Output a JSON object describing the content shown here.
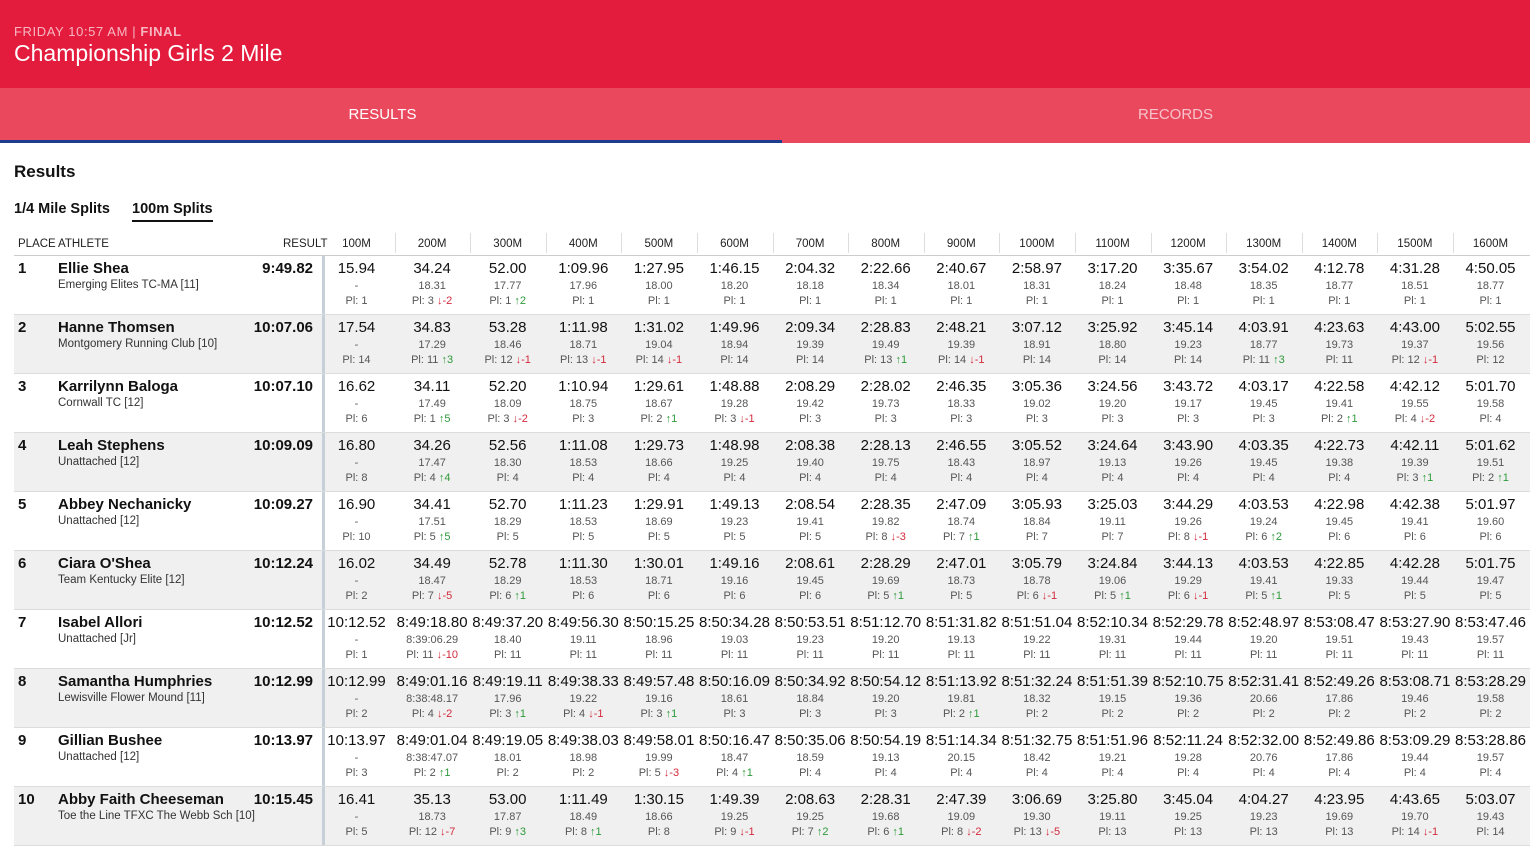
{
  "header": {
    "day_time": "FRIDAY 10:57 AM | ",
    "status": "FINAL",
    "title": "Championship Girls 2 Mile"
  },
  "tabs": [
    {
      "label": "RESULTS",
      "active": true
    },
    {
      "label": "RECORDS",
      "active": false
    }
  ],
  "section_title": "Results",
  "split_tabs": [
    {
      "label": "1/4 Mile Splits",
      "active": false
    },
    {
      "label": "100m Splits",
      "active": true
    }
  ],
  "columns": {
    "place": "PLACE",
    "athlete": "ATHLETE",
    "result": "RESULT",
    "splits": [
      "100M",
      "200M",
      "300M",
      "400M",
      "500M",
      "600M",
      "700M",
      "800M",
      "900M",
      "1000M",
      "1100M",
      "1200M",
      "1300M",
      "1400M",
      "1500M",
      "1600M"
    ]
  },
  "colors": {
    "header_bg": "#e31c3d",
    "tab_bg": "#e9485d",
    "tab_indicator": "#1e3d8f",
    "up": "#2e9a3a",
    "down": "#d42a3c"
  },
  "rows": [
    {
      "place": "1",
      "name": "Ellie Shea",
      "team": "Emerging Elites TC-MA [11]",
      "result": "9:49.82",
      "splits": [
        [
          "15.94",
          "-",
          "Pl: 1"
        ],
        [
          "34.24",
          "18.31",
          "Pl: 3",
          "↓-2"
        ],
        [
          "52.00",
          "17.77",
          "Pl: 1",
          "↑2"
        ],
        [
          "1:09.96",
          "17.96",
          "Pl: 1"
        ],
        [
          "1:27.95",
          "18.00",
          "Pl: 1"
        ],
        [
          "1:46.15",
          "18.20",
          "Pl: 1"
        ],
        [
          "2:04.32",
          "18.18",
          "Pl: 1"
        ],
        [
          "2:22.66",
          "18.34",
          "Pl: 1"
        ],
        [
          "2:40.67",
          "18.01",
          "Pl: 1"
        ],
        [
          "2:58.97",
          "18.31",
          "Pl: 1"
        ],
        [
          "3:17.20",
          "18.24",
          "Pl: 1"
        ],
        [
          "3:35.67",
          "18.48",
          "Pl: 1"
        ],
        [
          "3:54.02",
          "18.35",
          "Pl: 1"
        ],
        [
          "4:12.78",
          "18.77",
          "Pl: 1"
        ],
        [
          "4:31.28",
          "18.51",
          "Pl: 1"
        ],
        [
          "4:50.05",
          "18.77",
          "Pl: 1"
        ]
      ]
    },
    {
      "place": "2",
      "name": "Hanne Thomsen",
      "team": "Montgomery Running Club [10]",
      "result": "10:07.06",
      "splits": [
        [
          "17.54",
          "-",
          "Pl: 14"
        ],
        [
          "34.83",
          "17.29",
          "Pl: 11",
          "↑3"
        ],
        [
          "53.28",
          "18.46",
          "Pl: 12",
          "↓-1"
        ],
        [
          "1:11.98",
          "18.71",
          "Pl: 13",
          "↓-1"
        ],
        [
          "1:31.02",
          "19.04",
          "Pl: 14",
          "↓-1"
        ],
        [
          "1:49.96",
          "18.94",
          "Pl: 14"
        ],
        [
          "2:09.34",
          "19.39",
          "Pl: 14"
        ],
        [
          "2:28.83",
          "19.49",
          "Pl: 13",
          "↑1"
        ],
        [
          "2:48.21",
          "19.39",
          "Pl: 14",
          "↓-1"
        ],
        [
          "3:07.12",
          "18.91",
          "Pl: 14"
        ],
        [
          "3:25.92",
          "18.80",
          "Pl: 14"
        ],
        [
          "3:45.14",
          "19.23",
          "Pl: 14"
        ],
        [
          "4:03.91",
          "18.77",
          "Pl: 11",
          "↑3"
        ],
        [
          "4:23.63",
          "19.73",
          "Pl: 11"
        ],
        [
          "4:43.00",
          "19.37",
          "Pl: 12",
          "↓-1"
        ],
        [
          "5:02.55",
          "19.56",
          "Pl: 12"
        ]
      ]
    },
    {
      "place": "3",
      "name": "Karrilynn Baloga",
      "team": "Cornwall TC [12]",
      "result": "10:07.10",
      "splits": [
        [
          "16.62",
          "-",
          "Pl: 6"
        ],
        [
          "34.11",
          "17.49",
          "Pl: 1",
          "↑5"
        ],
        [
          "52.20",
          "18.09",
          "Pl: 3",
          "↓-2"
        ],
        [
          "1:10.94",
          "18.75",
          "Pl: 3"
        ],
        [
          "1:29.61",
          "18.67",
          "Pl: 2",
          "↑1"
        ],
        [
          "1:48.88",
          "19.28",
          "Pl: 3",
          "↓-1"
        ],
        [
          "2:08.29",
          "19.42",
          "Pl: 3"
        ],
        [
          "2:28.02",
          "19.73",
          "Pl: 3"
        ],
        [
          "2:46.35",
          "18.33",
          "Pl: 3"
        ],
        [
          "3:05.36",
          "19.02",
          "Pl: 3"
        ],
        [
          "3:24.56",
          "19.20",
          "Pl: 3"
        ],
        [
          "3:43.72",
          "19.17",
          "Pl: 3"
        ],
        [
          "4:03.17",
          "19.45",
          "Pl: 3"
        ],
        [
          "4:22.58",
          "19.41",
          "Pl: 2",
          "↑1"
        ],
        [
          "4:42.12",
          "19.55",
          "Pl: 4",
          "↓-2"
        ],
        [
          "5:01.70",
          "19.58",
          "Pl: 4"
        ]
      ]
    },
    {
      "place": "4",
      "name": "Leah Stephens",
      "team": "Unattached [12]",
      "result": "10:09.09",
      "splits": [
        [
          "16.80",
          "-",
          "Pl: 8"
        ],
        [
          "34.26",
          "17.47",
          "Pl: 4",
          "↑4"
        ],
        [
          "52.56",
          "18.30",
          "Pl: 4"
        ],
        [
          "1:11.08",
          "18.53",
          "Pl: 4"
        ],
        [
          "1:29.73",
          "18.66",
          "Pl: 4"
        ],
        [
          "1:48.98",
          "19.25",
          "Pl: 4"
        ],
        [
          "2:08.38",
          "19.40",
          "Pl: 4"
        ],
        [
          "2:28.13",
          "19.75",
          "Pl: 4"
        ],
        [
          "2:46.55",
          "18.43",
          "Pl: 4"
        ],
        [
          "3:05.52",
          "18.97",
          "Pl: 4"
        ],
        [
          "3:24.64",
          "19.13",
          "Pl: 4"
        ],
        [
          "3:43.90",
          "19.26",
          "Pl: 4"
        ],
        [
          "4:03.35",
          "19.45",
          "Pl: 4"
        ],
        [
          "4:22.73",
          "19.38",
          "Pl: 4"
        ],
        [
          "4:42.11",
          "19.39",
          "Pl: 3",
          "↑1"
        ],
        [
          "5:01.62",
          "19.51",
          "Pl: 2",
          "↑1"
        ]
      ]
    },
    {
      "place": "5",
      "name": "Abbey Nechanicky",
      "team": "Unattached [12]",
      "result": "10:09.27",
      "splits": [
        [
          "16.90",
          "-",
          "Pl: 10"
        ],
        [
          "34.41",
          "17.51",
          "Pl: 5",
          "↑5"
        ],
        [
          "52.70",
          "18.29",
          "Pl: 5"
        ],
        [
          "1:11.23",
          "18.53",
          "Pl: 5"
        ],
        [
          "1:29.91",
          "18.69",
          "Pl: 5"
        ],
        [
          "1:49.13",
          "19.23",
          "Pl: 5"
        ],
        [
          "2:08.54",
          "19.41",
          "Pl: 5"
        ],
        [
          "2:28.35",
          "19.82",
          "Pl: 8",
          "↓-3"
        ],
        [
          "2:47.09",
          "18.74",
          "Pl: 7",
          "↑1"
        ],
        [
          "3:05.93",
          "18.84",
          "Pl: 7"
        ],
        [
          "3:25.03",
          "19.11",
          "Pl: 7"
        ],
        [
          "3:44.29",
          "19.26",
          "Pl: 8",
          "↓-1"
        ],
        [
          "4:03.53",
          "19.24",
          "Pl: 6",
          "↑2"
        ],
        [
          "4:22.98",
          "19.45",
          "Pl: 6"
        ],
        [
          "4:42.38",
          "19.41",
          "Pl: 6"
        ],
        [
          "5:01.97",
          "19.60",
          "Pl: 6"
        ]
      ]
    },
    {
      "place": "6",
      "name": "Ciara O'Shea",
      "team": "Team Kentucky Elite [12]",
      "result": "10:12.24",
      "splits": [
        [
          "16.02",
          "-",
          "Pl: 2"
        ],
        [
          "34.49",
          "18.47",
          "Pl: 7",
          "↓-5"
        ],
        [
          "52.78",
          "18.29",
          "Pl: 6",
          "↑1"
        ],
        [
          "1:11.30",
          "18.53",
          "Pl: 6"
        ],
        [
          "1:30.01",
          "18.71",
          "Pl: 6"
        ],
        [
          "1:49.16",
          "19.16",
          "Pl: 6"
        ],
        [
          "2:08.61",
          "19.45",
          "Pl: 6"
        ],
        [
          "2:28.29",
          "19.69",
          "Pl: 5",
          "↑1"
        ],
        [
          "2:47.01",
          "18.73",
          "Pl: 5"
        ],
        [
          "3:05.79",
          "18.78",
          "Pl: 6",
          "↓-1"
        ],
        [
          "3:24.84",
          "19.06",
          "Pl: 5",
          "↑1"
        ],
        [
          "3:44.13",
          "19.29",
          "Pl: 6",
          "↓-1"
        ],
        [
          "4:03.53",
          "19.41",
          "Pl: 5",
          "↑1"
        ],
        [
          "4:22.85",
          "19.33",
          "Pl: 5"
        ],
        [
          "4:42.28",
          "19.44",
          "Pl: 5"
        ],
        [
          "5:01.75",
          "19.47",
          "Pl: 5"
        ]
      ]
    },
    {
      "place": "7",
      "name": "Isabel Allori",
      "team": "Unattached [Jr]",
      "result": "10:12.52",
      "splits": [
        [
          "10:12.52",
          "-",
          "Pl: 1"
        ],
        [
          "8:49:18.80",
          "8:39:06.29",
          "Pl: 11",
          "↓-10"
        ],
        [
          "8:49:37.20",
          "18.40",
          "Pl: 11"
        ],
        [
          "8:49:56.30",
          "19.11",
          "Pl: 11"
        ],
        [
          "8:50:15.25",
          "18.96",
          "Pl: 11"
        ],
        [
          "8:50:34.28",
          "19.03",
          "Pl: 11"
        ],
        [
          "8:50:53.51",
          "19.23",
          "Pl: 11"
        ],
        [
          "8:51:12.70",
          "19.20",
          "Pl: 11"
        ],
        [
          "8:51:31.82",
          "19.13",
          "Pl: 11"
        ],
        [
          "8:51:51.04",
          "19.22",
          "Pl: 11"
        ],
        [
          "8:52:10.34",
          "19.31",
          "Pl: 11"
        ],
        [
          "8:52:29.78",
          "19.44",
          "Pl: 11"
        ],
        [
          "8:52:48.97",
          "19.20",
          "Pl: 11"
        ],
        [
          "8:53:08.47",
          "19.51",
          "Pl: 11"
        ],
        [
          "8:53:27.90",
          "19.43",
          "Pl: 11"
        ],
        [
          "8:53:47.46",
          "19.57",
          "Pl: 11"
        ]
      ]
    },
    {
      "place": "8",
      "name": "Samantha Humphries",
      "team": "Lewisville Flower Mound [11]",
      "result": "10:12.99",
      "splits": [
        [
          "10:12.99",
          "-",
          "Pl: 2"
        ],
        [
          "8:49:01.16",
          "8:38:48.17",
          "Pl: 4",
          "↓-2"
        ],
        [
          "8:49:19.11",
          "17.96",
          "Pl: 3",
          "↑1"
        ],
        [
          "8:49:38.33",
          "19.22",
          "Pl: 4",
          "↓-1"
        ],
        [
          "8:49:57.48",
          "19.16",
          "Pl: 3",
          "↑1"
        ],
        [
          "8:50:16.09",
          "18.61",
          "Pl: 3"
        ],
        [
          "8:50:34.92",
          "18.84",
          "Pl: 3"
        ],
        [
          "8:50:54.12",
          "19.20",
          "Pl: 3"
        ],
        [
          "8:51:13.92",
          "19.81",
          "Pl: 2",
          "↑1"
        ],
        [
          "8:51:32.24",
          "18.32",
          "Pl: 2"
        ],
        [
          "8:51:51.39",
          "19.15",
          "Pl: 2"
        ],
        [
          "8:52:10.75",
          "19.36",
          "Pl: 2"
        ],
        [
          "8:52:31.41",
          "20.66",
          "Pl: 2"
        ],
        [
          "8:52:49.26",
          "17.86",
          "Pl: 2"
        ],
        [
          "8:53:08.71",
          "19.46",
          "Pl: 2"
        ],
        [
          "8:53:28.29",
          "19.58",
          "Pl: 2"
        ]
      ]
    },
    {
      "place": "9",
      "name": "Gillian Bushee",
      "team": "Unattached [12]",
      "result": "10:13.97",
      "splits": [
        [
          "10:13.97",
          "-",
          "Pl: 3"
        ],
        [
          "8:49:01.04",
          "8:38:47.07",
          "Pl: 2",
          "↑1"
        ],
        [
          "8:49:19.05",
          "18.01",
          "Pl: 2"
        ],
        [
          "8:49:38.03",
          "18.98",
          "Pl: 2"
        ],
        [
          "8:49:58.01",
          "19.99",
          "Pl: 5",
          "↓-3"
        ],
        [
          "8:50:16.47",
          "18.47",
          "Pl: 4",
          "↑1"
        ],
        [
          "8:50:35.06",
          "18.59",
          "Pl: 4"
        ],
        [
          "8:50:54.19",
          "19.13",
          "Pl: 4"
        ],
        [
          "8:51:14.34",
          "20.15",
          "Pl: 4"
        ],
        [
          "8:51:32.75",
          "18.42",
          "Pl: 4"
        ],
        [
          "8:51:51.96",
          "19.21",
          "Pl: 4"
        ],
        [
          "8:52:11.24",
          "19.28",
          "Pl: 4"
        ],
        [
          "8:52:32.00",
          "20.76",
          "Pl: 4"
        ],
        [
          "8:52:49.86",
          "17.86",
          "Pl: 4"
        ],
        [
          "8:53:09.29",
          "19.44",
          "Pl: 4"
        ],
        [
          "8:53:28.86",
          "19.57",
          "Pl: 4"
        ]
      ]
    },
    {
      "place": "10",
      "name": "Abby Faith Cheeseman",
      "team": "Toe the Line TFXC The Webb Sch [10]",
      "result": "10:15.45",
      "splits": [
        [
          "16.41",
          "-",
          "Pl: 5"
        ],
        [
          "35.13",
          "18.73",
          "Pl: 12",
          "↓-7"
        ],
        [
          "53.00",
          "17.87",
          "Pl: 9",
          "↑3"
        ],
        [
          "1:11.49",
          "18.49",
          "Pl: 8",
          "↑1"
        ],
        [
          "1:30.15",
          "18.66",
          "Pl: 8"
        ],
        [
          "1:49.39",
          "19.25",
          "Pl: 9",
          "↓-1"
        ],
        [
          "2:08.63",
          "19.25",
          "Pl: 7",
          "↑2"
        ],
        [
          "2:28.31",
          "19.68",
          "Pl: 6",
          "↑1"
        ],
        [
          "2:47.39",
          "19.09",
          "Pl: 8",
          "↓-2"
        ],
        [
          "3:06.69",
          "19.30",
          "Pl: 13",
          "↓-5"
        ],
        [
          "3:25.80",
          "19.11",
          "Pl: 13"
        ],
        [
          "3:45.04",
          "19.25",
          "Pl: 13"
        ],
        [
          "4:04.27",
          "19.23",
          "Pl: 13"
        ],
        [
          "4:23.95",
          "19.69",
          "Pl: 13"
        ],
        [
          "4:43.65",
          "19.70",
          "Pl: 14",
          "↓-1"
        ],
        [
          "5:03.07",
          "19.43",
          "Pl: 14"
        ]
      ]
    }
  ]
}
